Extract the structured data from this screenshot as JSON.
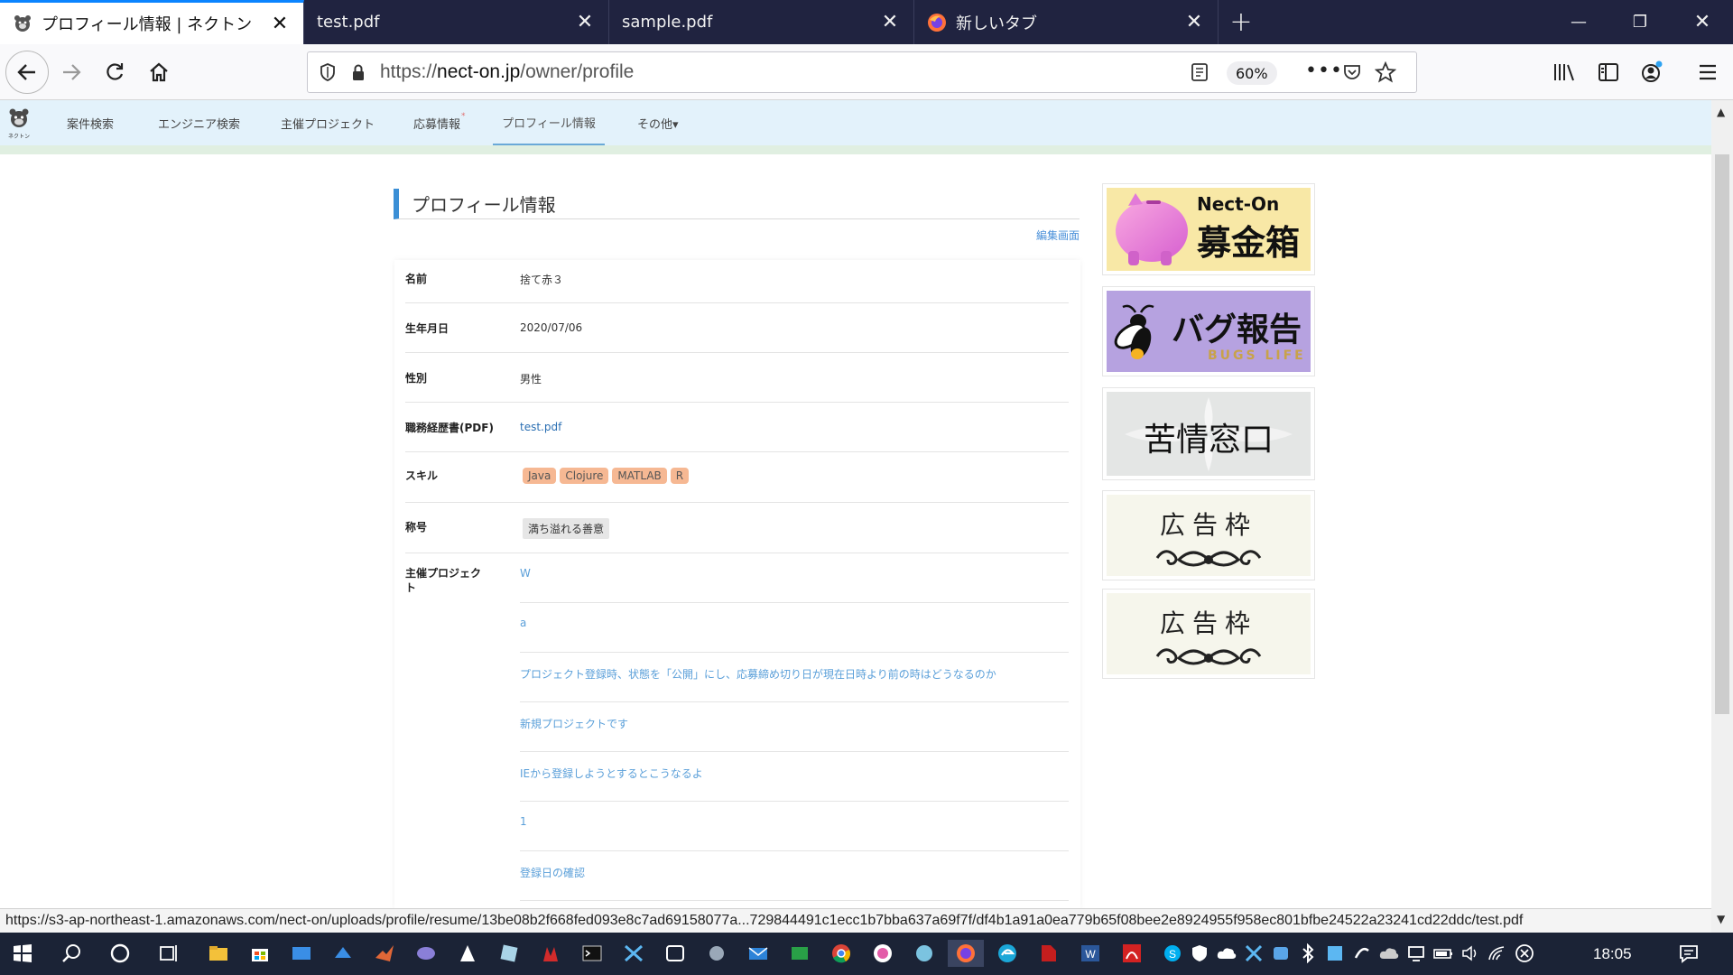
{
  "browser": {
    "tabs": [
      {
        "title": "プロフィール情報 | ネクトン",
        "active": true,
        "icon": "site-tanuki-icon"
      },
      {
        "title": "test.pdf",
        "active": false,
        "icon": ""
      },
      {
        "title": "sample.pdf",
        "active": false,
        "icon": ""
      },
      {
        "title": "新しいタブ",
        "active": false,
        "icon": "firefox-icon"
      }
    ],
    "url_scheme": "https://",
    "url_domain": "nect-on.jp",
    "url_path": "/owner/profile",
    "zoom": "60%"
  },
  "site_nav": {
    "items": [
      {
        "label": "案件検索"
      },
      {
        "label": "エンジニア検索"
      },
      {
        "label": "主催プロジェクト"
      },
      {
        "label": "応募情報",
        "badge": "*"
      },
      {
        "label": "プロフィール情報",
        "active": true
      },
      {
        "label": "その他▾"
      }
    ],
    "logo_caption": "ネクトン"
  },
  "profile": {
    "heading": "プロフィール情報",
    "edit_link": "編集画面",
    "fields": {
      "name": {
        "label": "名前",
        "value": "捨て赤３"
      },
      "birthday": {
        "label": "生年月日",
        "value": "2020/07/06"
      },
      "gender": {
        "label": "性別",
        "value": "男性"
      },
      "resume": {
        "label": "職務経歴書(PDF)",
        "value": "test.pdf"
      },
      "skills": {
        "label": "スキル",
        "values": [
          "Java",
          "Clojure",
          "MATLAB",
          "R"
        ]
      },
      "title": {
        "label": "称号",
        "value": "満ち溢れる善意"
      },
      "projects": {
        "label": "主催プロジェクト"
      }
    },
    "projects": [
      "W",
      "a",
      "プロジェクト登録時、状態を「公開」にし、応募締め切り日が現在日時より前の時はどうなるのか",
      "新規プロジェクトです",
      "IEから登録しようとするとこうなるよ",
      "1",
      "登録日の確認"
    ]
  },
  "sidebar": {
    "donation": {
      "brand": "Nect-On",
      "label": "募金箱"
    },
    "bug_report": {
      "label": "バグ報告",
      "sub": "BUGS LIFE"
    },
    "complaint": {
      "label": "苦情窓口"
    },
    "ads": [
      {
        "label": "広告枠"
      },
      {
        "label": "広告枠"
      }
    ]
  },
  "status_url": "https://s3-ap-northeast-1.amazonaws.com/nect-on/uploads/profile/resume/13be08b2f668fed093e8c7ad69158077a...729844491c1ecc1b7bba637a69f7f/df4b1a91a0ea779b65f08bee2e8924955f958ec801bfbe24522a23241cd22ddc/test.pdf",
  "taskbar": {
    "time": "18:05"
  }
}
